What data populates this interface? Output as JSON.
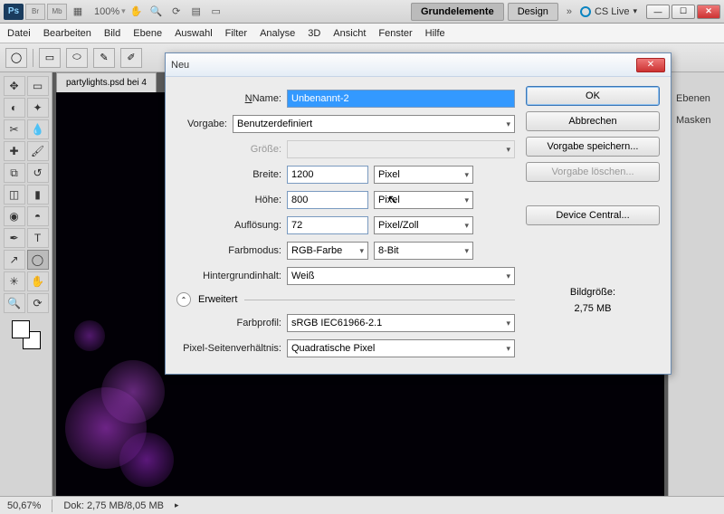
{
  "app": {
    "logo": "Ps",
    "mini1": "Br",
    "mini2": "Mb",
    "zoom": "100%"
  },
  "workspace": {
    "active": "Grundelemente",
    "second": "Design",
    "cslive": "CS Live"
  },
  "menu": [
    "Datei",
    "Bearbeiten",
    "Bild",
    "Ebene",
    "Auswahl",
    "Filter",
    "Analyse",
    "3D",
    "Ansicht",
    "Fenster",
    "Hilfe"
  ],
  "doc_tab": "partylights.psd bei 4",
  "panels": {
    "p1": "Ebenen",
    "p2": "Masken"
  },
  "status": {
    "zoom": "50,67%",
    "doc": "Dok: 2,75 MB/8,05 MB"
  },
  "dialog": {
    "title": "Neu",
    "name_label": "Name:",
    "name_value": "Unbenannt-2",
    "preset_label": "Vorgabe:",
    "preset_value": "Benutzerdefiniert",
    "size_label": "Größe:",
    "width_label": "Breite:",
    "width_value": "1200",
    "width_unit": "Pixel",
    "height_label": "Höhe:",
    "height_value": "800",
    "height_unit": "Pixel",
    "res_label": "Auflösung:",
    "res_value": "72",
    "res_unit": "Pixel/Zoll",
    "mode_label": "Farbmodus:",
    "mode_value": "RGB-Farbe",
    "mode_depth": "8-Bit",
    "bg_label": "Hintergrundinhalt:",
    "bg_value": "Weiß",
    "advanced": "Erweitert",
    "profile_label": "Farbprofil:",
    "profile_value": "sRGB IEC61966-2.1",
    "aspect_label": "Pixel-Seitenverhältnis:",
    "aspect_value": "Quadratische Pixel",
    "ok": "OK",
    "cancel": "Abbrechen",
    "save_preset": "Vorgabe speichern...",
    "delete_preset": "Vorgabe löschen...",
    "device_central": "Device Central...",
    "imagesize_label": "Bildgröße:",
    "imagesize_value": "2,75 MB"
  }
}
